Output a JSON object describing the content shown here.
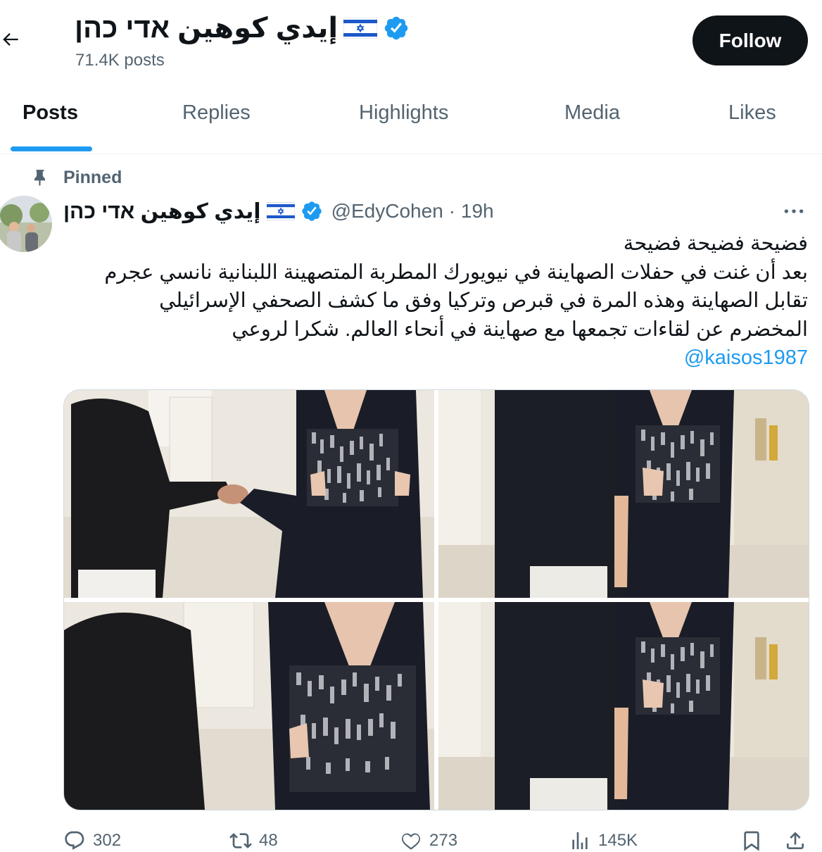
{
  "profile": {
    "name": "إيدي كوهين אדי כהן",
    "posts_count": "71.4K posts",
    "follow_label": "Follow"
  },
  "tabs": [
    {
      "label": "Posts",
      "active": true
    },
    {
      "label": "Replies"
    },
    {
      "label": "Highlights"
    },
    {
      "label": "Media"
    },
    {
      "label": "Likes"
    }
  ],
  "tweet": {
    "pinned_label": "Pinned",
    "author_name": "إيدي كوهين אדי כהן",
    "handle": "@EdyCohen",
    "time": "· 19h",
    "text_lines": [
      "فضيحة فضيحة فضيحة",
      "بعد أن غنت في حفلات الصهاينة في نيويورك المطربة المتصهينة اللبنانية نانسي عجرم",
      "تقابل الصهاينة وهذه المرة في قبرص وتركيا وفق ما كشف الصحفي الإسرائيلي",
      "المخضرم عن لقاءات تجمعها مع صهاينة في أنحاء العالم. شكرا لروعي"
    ],
    "mention": "@kaisos1987",
    "actions": {
      "replies": "302",
      "reposts": "48",
      "likes": "273",
      "views": "145K"
    }
  },
  "colors": {
    "accent": "#1d9bf0",
    "text": "#0f1419",
    "secondary": "#536471",
    "follow_bg": "#0f1419"
  },
  "icons": [
    "back-arrow-icon",
    "israel-flag-icon",
    "verified-badge-icon",
    "pin-icon",
    "more-icon",
    "reply-icon",
    "repost-icon",
    "like-icon",
    "views-icon",
    "bookmark-icon",
    "share-icon"
  ]
}
